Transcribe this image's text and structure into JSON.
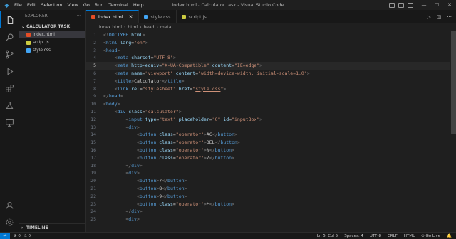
{
  "titlebar": {
    "menu": [
      "File",
      "Edit",
      "Selection",
      "View",
      "Go",
      "Run",
      "Terminal",
      "Help"
    ],
    "title": "index.html - Calculator task - Visual Studio Code"
  },
  "sidebar": {
    "header": "EXPLORER",
    "more": "···",
    "folder": "CALCULATOR TASK",
    "files": [
      {
        "name": "index.html",
        "type": "html",
        "active": true
      },
      {
        "name": "script.js",
        "type": "js",
        "active": false
      },
      {
        "name": "style.css",
        "type": "css",
        "active": false
      }
    ],
    "timeline": "TIMELINE"
  },
  "tabs": [
    {
      "label": "index.html",
      "type": "html",
      "active": true
    },
    {
      "label": "style.css",
      "type": "css",
      "active": false
    },
    {
      "label": "script.js",
      "type": "js",
      "active": false
    }
  ],
  "breadcrumb": [
    "index.html",
    "html",
    "head",
    "meta"
  ],
  "code_lines": [
    {
      "n": "1",
      "html": "<span class=\"p\">&lt;!</span><span class=\"t\">DOCTYPE</span> <span class=\"a\">html</span><span class=\"p\">&gt;</span>"
    },
    {
      "n": "2",
      "html": "<span class=\"p\">&lt;</span><span class=\"t\">html</span> <span class=\"a\">lang</span>=<span class=\"s\">\"en\"</span><span class=\"p\">&gt;</span>"
    },
    {
      "n": "3",
      "html": "<span class=\"p\">&lt;</span><span class=\"t\">head</span><span class=\"p\">&gt;</span>"
    },
    {
      "n": "4",
      "html": "    <span class=\"p\">&lt;</span><span class=\"t\">meta</span> <span class=\"a\">charset</span>=<span class=\"s\">\"UTF-8\"</span><span class=\"p\">&gt;</span>"
    },
    {
      "n": "5",
      "cur": true,
      "html": "    <span class=\"p\">&lt;</span><span class=\"t\">meta</span> <span class=\"a\">http-equiv</span>=<span class=\"s\">\"X-UA-Compatible\"</span> <span class=\"a\">content</span>=<span class=\"s\">\"IE=edge\"</span><span class=\"p\">&gt;</span>"
    },
    {
      "n": "6",
      "html": "    <span class=\"p\">&lt;</span><span class=\"t\">meta</span> <span class=\"a\">name</span>=<span class=\"s\">\"viewport\"</span> <span class=\"a\">content</span>=<span class=\"s\">\"width=device-width, initial-scale=1.0\"</span><span class=\"p\">&gt;</span>"
    },
    {
      "n": "7",
      "html": "    <span class=\"p\">&lt;</span><span class=\"t\">title</span><span class=\"p\">&gt;</span>Calculator<span class=\"p\">&lt;/</span><span class=\"t\">title</span><span class=\"p\">&gt;</span>"
    },
    {
      "n": "8",
      "html": "    <span class=\"p\">&lt;</span><span class=\"t\">link</span> <span class=\"a\">rel</span>=<span class=\"s\">\"stylesheet\"</span> <span class=\"a\">href</span>=<span class=\"s\">\"<span class=\"u\">style.css</span>\"</span><span class=\"p\">&gt;</span>"
    },
    {
      "n": "9",
      "html": "<span class=\"p\">&lt;/</span><span class=\"t\">head</span><span class=\"p\">&gt;</span>"
    },
    {
      "n": "10",
      "html": "<span class=\"p\">&lt;</span><span class=\"t\">body</span><span class=\"p\">&gt;</span>"
    },
    {
      "n": "11",
      "html": "    <span class=\"p\">&lt;</span><span class=\"t\">div</span> <span class=\"a\">class</span>=<span class=\"s\">\"calculator\"</span><span class=\"p\">&gt;</span>"
    },
    {
      "n": "12",
      "html": "        <span class=\"p\">&lt;</span><span class=\"t\">input</span> <span class=\"a\">type</span>=<span class=\"s\">\"text\"</span> <span class=\"a\">placeholder</span>=<span class=\"s\">\"0\"</span> <span class=\"a\">id</span>=<span class=\"s\">\"inputBox\"</span><span class=\"p\">&gt;</span>"
    },
    {
      "n": "13",
      "html": "        <span class=\"p\">&lt;</span><span class=\"t\">div</span><span class=\"p\">&gt;</span>"
    },
    {
      "n": "14",
      "html": "            <span class=\"p\">&lt;</span><span class=\"t\">button</span> <span class=\"a\">class</span>=<span class=\"s\">\"operator\"</span><span class=\"p\">&gt;</span>AC<span class=\"p\">&lt;/</span><span class=\"t\">button</span><span class=\"p\">&gt;</span>"
    },
    {
      "n": "15",
      "html": "            <span class=\"p\">&lt;</span><span class=\"t\">button</span> <span class=\"a\">class</span>=<span class=\"s\">\"operator\"</span><span class=\"p\">&gt;</span>DEL<span class=\"p\">&lt;/</span><span class=\"t\">button</span><span class=\"p\">&gt;</span>"
    },
    {
      "n": "16",
      "html": "            <span class=\"p\">&lt;</span><span class=\"t\">button</span> <span class=\"a\">class</span>=<span class=\"s\">\"operator\"</span><span class=\"p\">&gt;</span>%<span class=\"p\">&lt;/</span><span class=\"t\">button</span><span class=\"p\">&gt;</span>"
    },
    {
      "n": "17",
      "html": "            <span class=\"p\">&lt;</span><span class=\"t\">button</span> <span class=\"a\">class</span>=<span class=\"s\">\"operator\"</span><span class=\"p\">&gt;</span>/<span class=\"p\">&lt;/</span><span class=\"t\">button</span><span class=\"p\">&gt;</span>"
    },
    {
      "n": "18",
      "html": "        <span class=\"p\">&lt;/</span><span class=\"t\">div</span><span class=\"p\">&gt;</span>"
    },
    {
      "n": "19",
      "html": "        <span class=\"p\">&lt;</span><span class=\"t\">div</span><span class=\"p\">&gt;</span>"
    },
    {
      "n": "20",
      "html": "            <span class=\"p\">&lt;</span><span class=\"t\">button</span><span class=\"p\">&gt;</span>7<span class=\"p\">&lt;/</span><span class=\"t\">button</span><span class=\"p\">&gt;</span>"
    },
    {
      "n": "21",
      "html": "            <span class=\"p\">&lt;</span><span class=\"t\">button</span><span class=\"p\">&gt;</span>8<span class=\"p\">&lt;/</span><span class=\"t\">button</span><span class=\"p\">&gt;</span>"
    },
    {
      "n": "22",
      "html": "            <span class=\"p\">&lt;</span><span class=\"t\">button</span><span class=\"p\">&gt;</span>9<span class=\"p\">&lt;/</span><span class=\"t\">button</span><span class=\"p\">&gt;</span>"
    },
    {
      "n": "23",
      "html": "            <span class=\"p\">&lt;</span><span class=\"t\">button</span> <span class=\"a\">class</span>=<span class=\"s\">\"operator\"</span><span class=\"p\">&gt;</span>*<span class=\"p\">&lt;/</span><span class=\"t\">button</span><span class=\"p\">&gt;</span>"
    },
    {
      "n": "24",
      "html": "        <span class=\"p\">&lt;/</span><span class=\"t\">div</span><span class=\"p\">&gt;</span>"
    },
    {
      "n": "25",
      "html": "        <span class=\"p\">&lt;</span><span class=\"t\">div</span><span class=\"p\">&gt;</span>"
    }
  ],
  "status": {
    "remote": "⇌",
    "errors": "⊗ 0",
    "warnings": "⚠ 0",
    "position": "Ln 5, Col 5",
    "spaces": "Spaces: 4",
    "encoding": "UTF-8",
    "eol": "CRLF",
    "language": "HTML",
    "golive": "⊙ Go Live",
    "bell": "🔔"
  },
  "colors": {
    "accent": "#0078d4",
    "editor_bg": "#1f1f1f",
    "tag": "#569cd6",
    "attr": "#9cdcfe",
    "string": "#ce9178"
  }
}
